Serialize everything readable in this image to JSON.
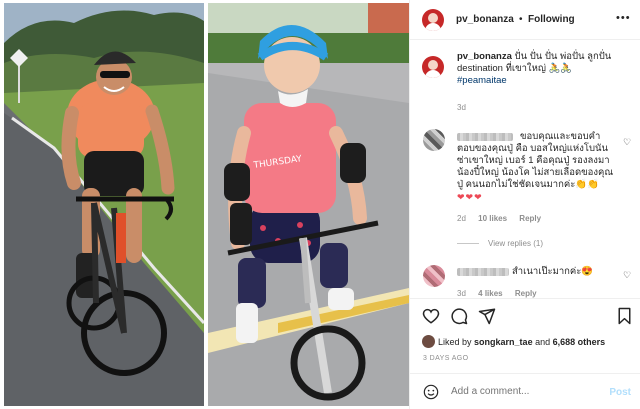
{
  "post": {
    "username": "pv_bonanza",
    "dot": "•",
    "follow_label": "Following",
    "caption_text": "ปั่น ปั่น ปั่น พ่อปั่น ลูกปั่น destination ที่เขาใหญ่ 🚴🚴",
    "hashtag": "#peamaitae",
    "caption_time": "3d"
  },
  "comments": [
    {
      "text": "ขอบคุณและขอบคำตอบของคุณปู่ คือ บอสใหญ่แห่งโบนันซ่าเขาใหญ่ เบอร์ 1 คือคุณปู่ รองลงมาน้องปี๋ใหญ่ น้องโค ไม่สายเลือดของคุณปู่ คนนอกไม่ใช่ชัดเจนมากค่ะ👏👏",
      "emoji_hearts": "❤❤❤",
      "time": "2d",
      "likes": "10 likes",
      "reply": "Reply",
      "view_replies": "View replies (1)"
    },
    {
      "text": "สำเนาเป๊ะมากค่ะ😍",
      "time": "3d",
      "likes": "4 likes",
      "reply": "Reply"
    }
  ],
  "likes": {
    "liked_by": "Liked by",
    "first": "songkarn_tae",
    "and": "and",
    "others": "6,688 others"
  },
  "posted_ago": "3 DAYS AGO",
  "add_comment": {
    "placeholder": "Add a comment...",
    "post_label": "Post"
  },
  "icons": [
    "more-icon",
    "heart-icon",
    "comment-icon",
    "share-icon",
    "bookmark-icon",
    "smile-icon"
  ],
  "colors": {
    "hashtag": "#00376b",
    "muted": "#8e8e8e",
    "post_disabled": "#b2dffc",
    "heart_red": "#ed4956",
    "avatar_red": "#c62828"
  },
  "photos": {
    "left_jersey_text": "",
    "right_shirt_text": "THURSDAY"
  }
}
